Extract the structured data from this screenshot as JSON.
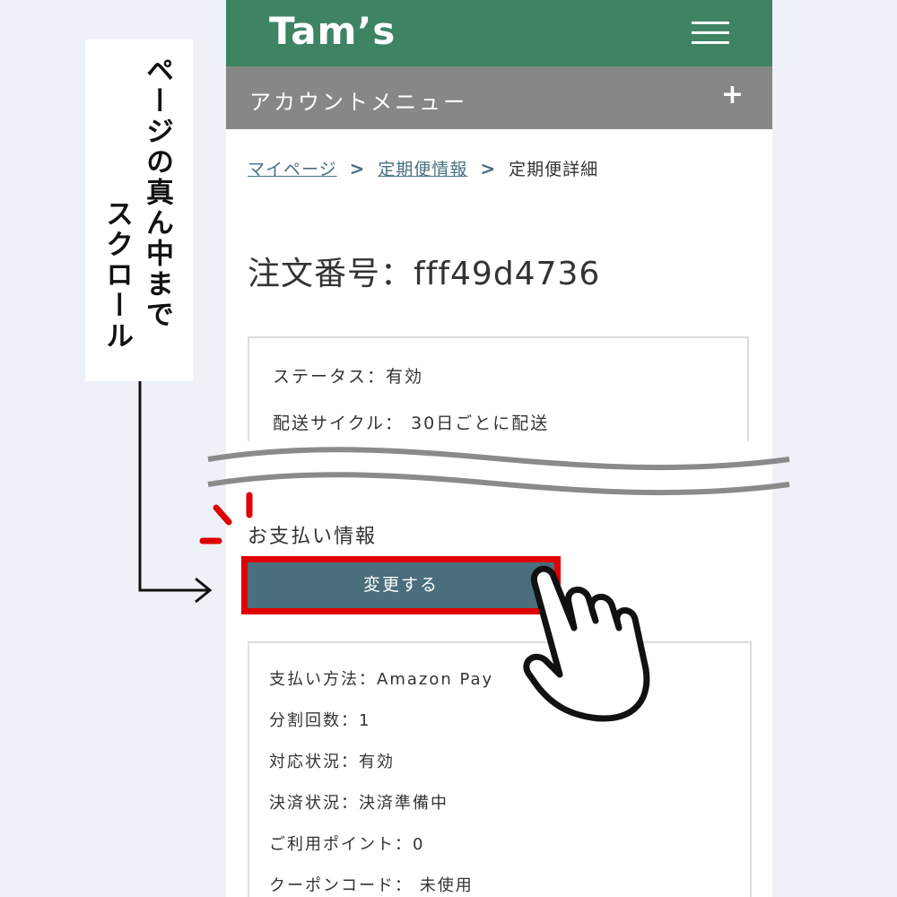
{
  "instruction": {
    "line1": "ページの真ん中まで",
    "line2": "スクロール"
  },
  "header": {
    "logo": "Tam’s",
    "brand_color": "#3e8463"
  },
  "account_menu": {
    "label": "アカウントメニュー",
    "expand": "+"
  },
  "breadcrumb": {
    "items": [
      "マイページ",
      "定期便情報"
    ],
    "current": "定期便詳細",
    "separator": ">"
  },
  "order": {
    "title": "注文番号：fff49d4736"
  },
  "subscription": {
    "status": "ステータス：有効",
    "cycle": "配送サイクル： 30日ごとに配送"
  },
  "payment": {
    "heading": "お支払い情報",
    "change_button": "変更する",
    "rows": [
      "支払い方法：Amazon Pay",
      "分割回数：1",
      "対応状況：有効",
      "決済状況：決済準備中",
      "ご利用ポイント：0",
      "クーポンコード： 未使用"
    ]
  },
  "colors": {
    "highlight": "#e00000",
    "button": "#4a6e7c",
    "account_bar": "#878787"
  }
}
